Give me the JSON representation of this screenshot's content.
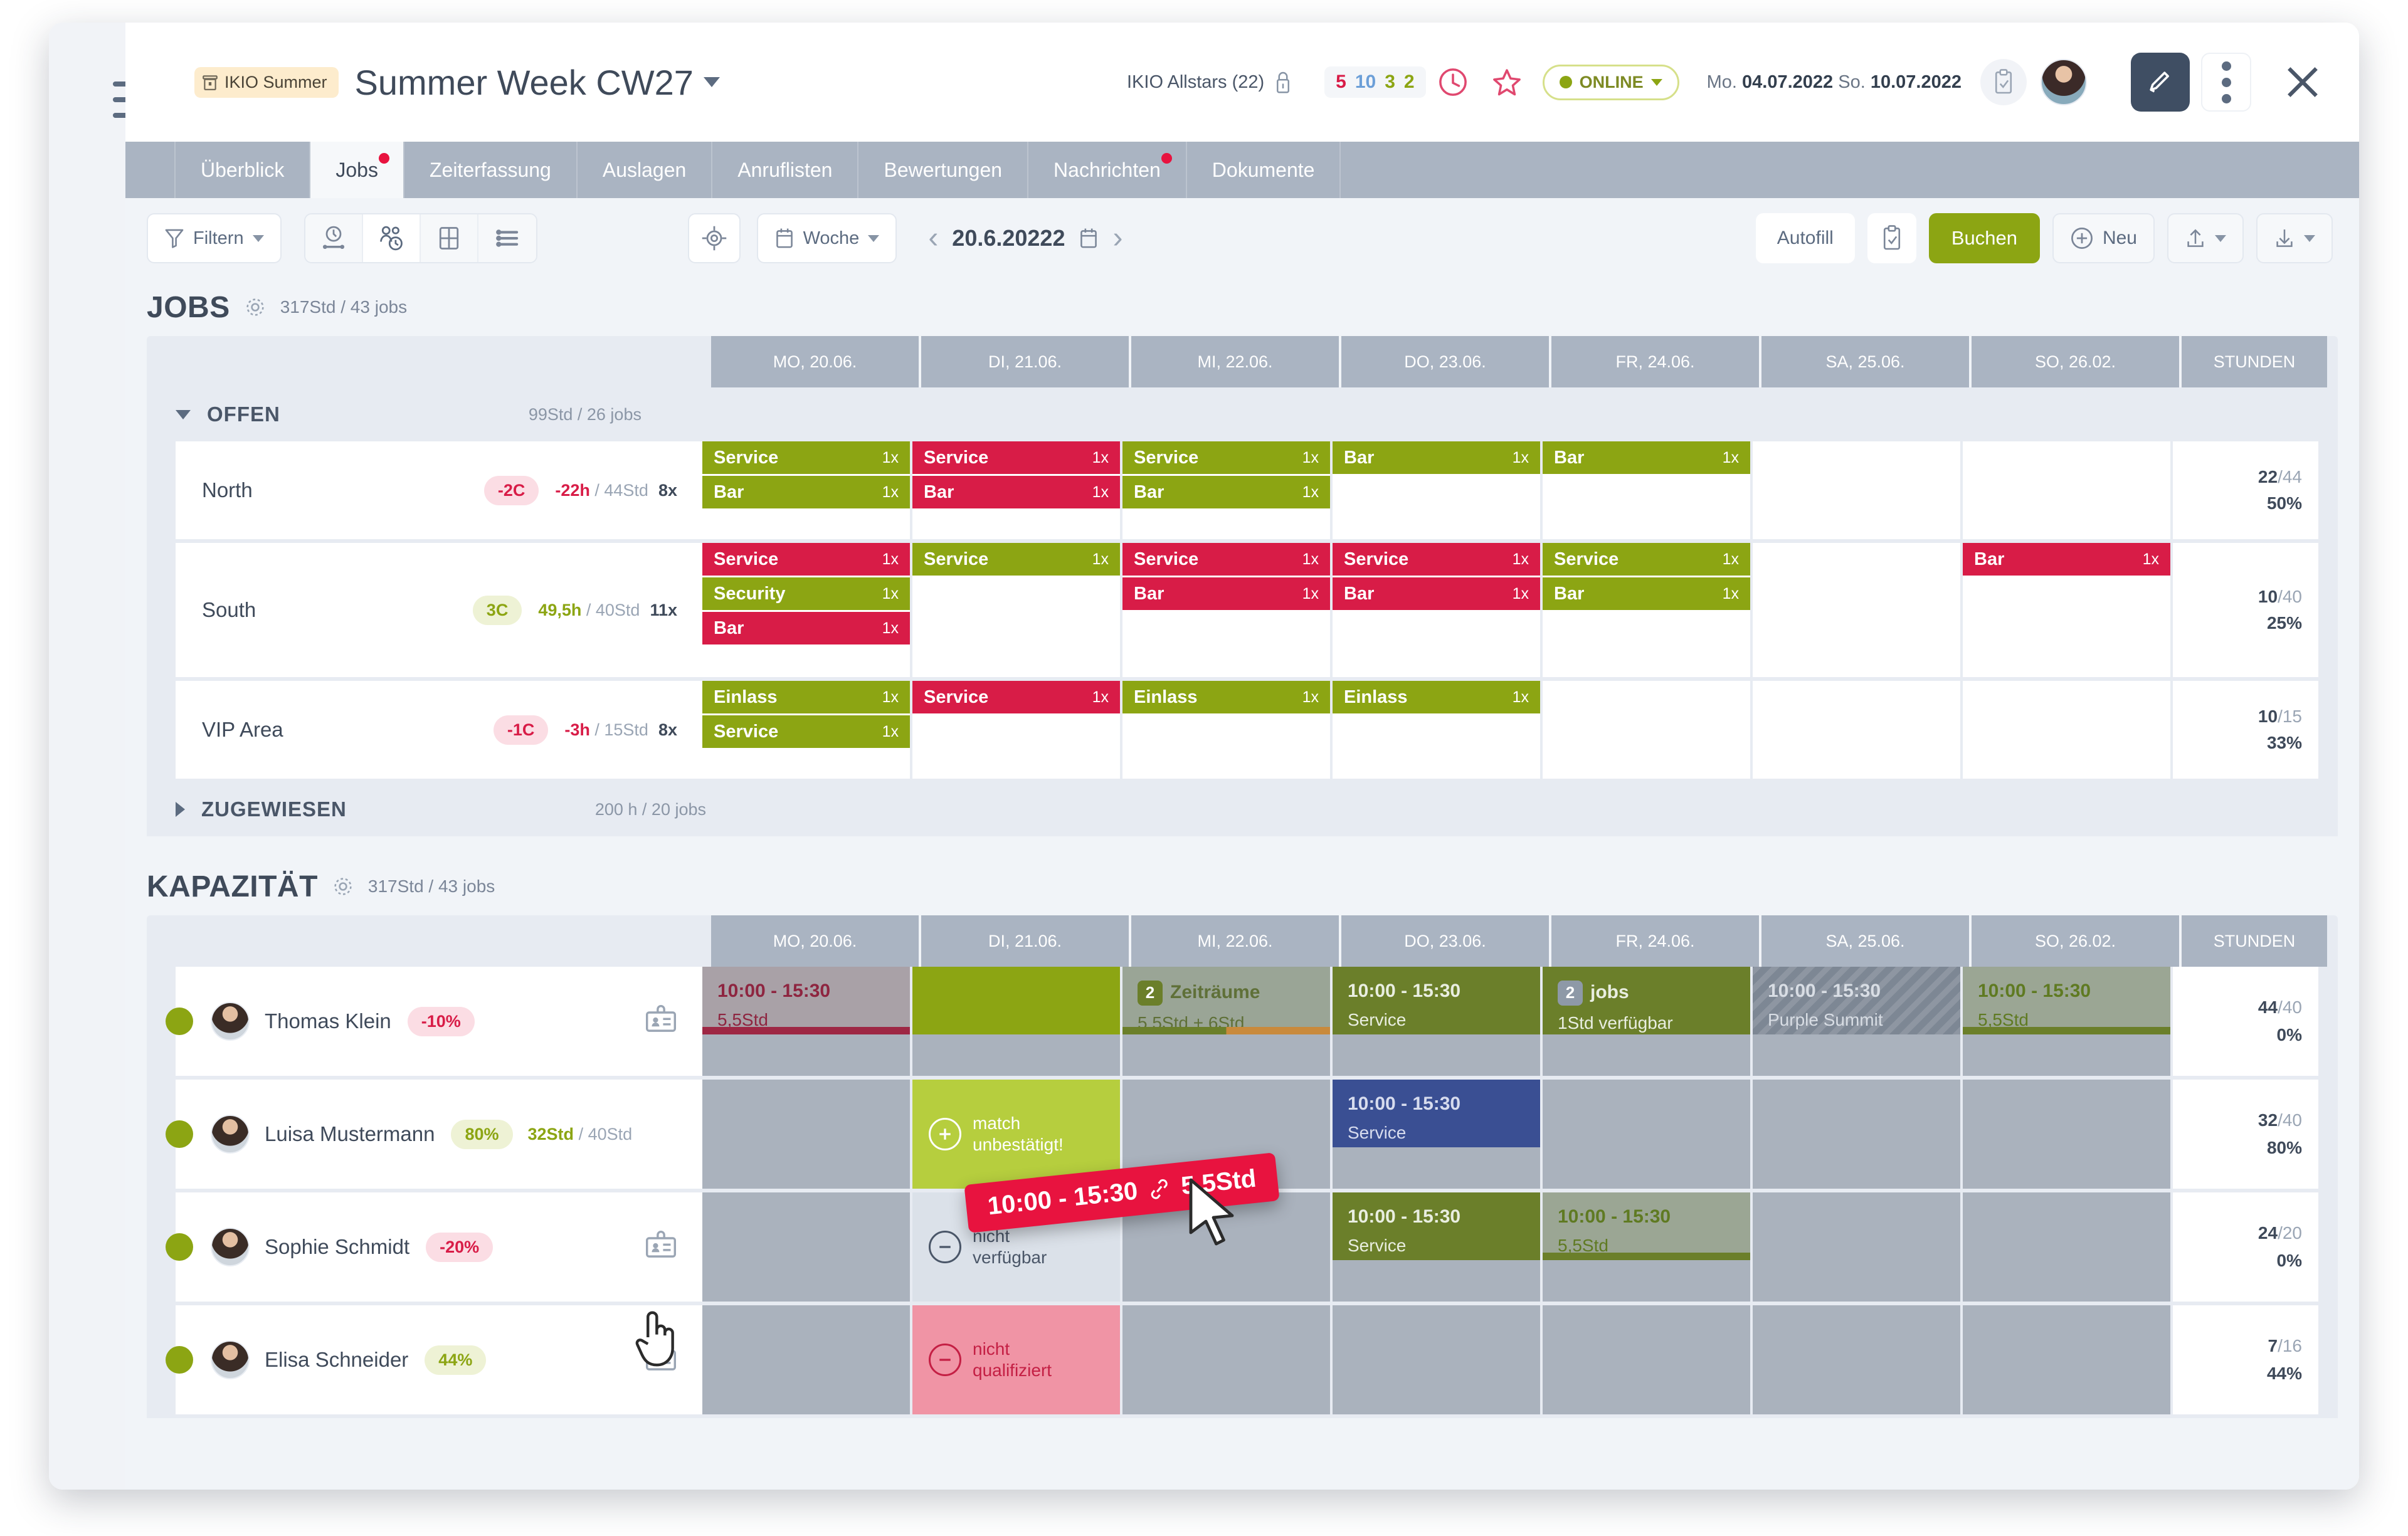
{
  "header": {
    "project_chip": "IKIO Summer",
    "project_chip_icon": "building-icon",
    "title": "Summer Week CW27",
    "team": "IKIO Allstars (22)",
    "lock_icon": "lock-icon",
    "counts": [
      "5",
      "10",
      "3",
      "2"
    ],
    "count_colors": [
      "#d81c47",
      "#6c9fd8",
      "#8ca513",
      "#8ca513"
    ],
    "clock_icon": "clock-icon",
    "star_icon": "star-icon",
    "status": "ONLINE",
    "date_prefix_from": "Mo.",
    "date_from": "04.07.2022",
    "date_prefix_to": "So.",
    "date_to": "10.07.2022",
    "clipboard_icon": "clipboard-check-icon",
    "avatar_icon": "user-avatar",
    "edit_icon": "pencil-icon",
    "more_icon": "kebab-menu-icon",
    "close_icon": "close-icon"
  },
  "tabs": [
    {
      "label": "Überblick",
      "active": false,
      "badge": false
    },
    {
      "label": "Jobs",
      "active": true,
      "badge": true
    },
    {
      "label": "Zeiterfassung",
      "active": false,
      "badge": false
    },
    {
      "label": "Auslagen",
      "active": false,
      "badge": false
    },
    {
      "label": "Anruflisten",
      "active": false,
      "badge": false
    },
    {
      "label": "Bewertungen",
      "active": false,
      "badge": false
    },
    {
      "label": "Nachrichten",
      "active": false,
      "badge": true
    },
    {
      "label": "Dokumente",
      "active": false,
      "badge": false
    }
  ],
  "toolbar": {
    "filter_label": "Filtern",
    "filter_icon": "funnel-icon",
    "view_buttons": [
      {
        "icon": "timeline-icon",
        "active": false
      },
      {
        "icon": "people-clock-icon",
        "active": true
      },
      {
        "icon": "grid-icon",
        "active": false
      },
      {
        "icon": "list-icon",
        "active": false
      }
    ],
    "target_icon": "crosshair-icon",
    "period_label": "Woche",
    "period_icon": "calendar-icon",
    "prev_icon": "chevron-left-icon",
    "next_icon": "chevron-right-icon",
    "current_date": "20.6.20222",
    "date_picker_icon": "calendar-icon",
    "autofill_label": "Autofill",
    "checklist_icon": "clipboard-check-icon",
    "book_label": "Buchen",
    "new_label": "Neu",
    "new_icon": "plus-circle-icon",
    "upload_icon": "upload-icon",
    "download_icon": "download-icon"
  },
  "jobs": {
    "title": "JOBS",
    "gear_icon": "gear-icon",
    "meta": "317Std / 43 jobs",
    "columns": [
      "MO, 20.06.",
      "DI, 21.06.",
      "MI, 22.06.",
      "DO, 23.06.",
      "FR, 24.06.",
      "SA, 25.06.",
      "SO, 26.02.",
      "STUNDEN"
    ],
    "groups": [
      {
        "name": "OFFEN",
        "meta": "99Std / 26 jobs",
        "expanded": true,
        "rows": [
          {
            "name": "North",
            "pill": "-2C",
            "pill_tone": "red",
            "hours": "-22h",
            "hours_tone": "red",
            "hours_total": "/ 44Std",
            "count": "8x",
            "days": [
              [
                {
                  "label": "Service",
                  "qty": "1x",
                  "tone": "g"
                },
                {
                  "label": "Bar",
                  "qty": "1x",
                  "tone": "g"
                }
              ],
              [
                {
                  "label": "Service",
                  "qty": "1x",
                  "tone": "r"
                },
                {
                  "label": "Bar",
                  "qty": "1x",
                  "tone": "r"
                }
              ],
              [
                {
                  "label": "Service",
                  "qty": "1x",
                  "tone": "g"
                },
                {
                  "label": "Bar",
                  "qty": "1x",
                  "tone": "g"
                }
              ],
              [
                {
                  "label": "Bar",
                  "qty": "1x",
                  "tone": "g"
                }
              ],
              [
                {
                  "label": "Bar",
                  "qty": "1x",
                  "tone": "g"
                }
              ],
              [],
              []
            ],
            "hours_cell": {
              "ratio": "22",
              "ratio_total": "/44",
              "pct": "50%"
            }
          },
          {
            "name": "South",
            "pill": "3C",
            "pill_tone": "green",
            "hours": "49,5h",
            "hours_tone": "green",
            "hours_total": "/ 40Std",
            "count": "11x",
            "days": [
              [
                {
                  "label": "Service",
                  "qty": "1x",
                  "tone": "r"
                },
                {
                  "label": "Security",
                  "qty": "1x",
                  "tone": "g"
                },
                {
                  "label": "Bar",
                  "qty": "1x",
                  "tone": "r"
                }
              ],
              [
                {
                  "label": "Service",
                  "qty": "1x",
                  "tone": "g"
                }
              ],
              [
                {
                  "label": "Service",
                  "qty": "1x",
                  "tone": "r"
                },
                {
                  "label": "Bar",
                  "qty": "1x",
                  "tone": "r"
                }
              ],
              [
                {
                  "label": "Service",
                  "qty": "1x",
                  "tone": "r"
                },
                {
                  "label": "Bar",
                  "qty": "1x",
                  "tone": "r"
                }
              ],
              [
                {
                  "label": "Service",
                  "qty": "1x",
                  "tone": "g"
                },
                {
                  "label": "Bar",
                  "qty": "1x",
                  "tone": "g"
                }
              ],
              [],
              [
                {
                  "label": "Bar",
                  "qty": "1x",
                  "tone": "r"
                }
              ]
            ],
            "hours_cell": {
              "ratio": "10",
              "ratio_total": "/40",
              "pct": "25%"
            }
          },
          {
            "name": "VIP Area",
            "pill": "-1C",
            "pill_tone": "red",
            "hours": "-3h",
            "hours_tone": "red",
            "hours_total": "/ 15Std",
            "count": "8x",
            "days": [
              [
                {
                  "label": "Einlass",
                  "qty": "1x",
                  "tone": "g"
                },
                {
                  "label": "Service",
                  "qty": "1x",
                  "tone": "g"
                }
              ],
              [
                {
                  "label": "Service",
                  "qty": "1x",
                  "tone": "r"
                }
              ],
              [
                {
                  "label": "Einlass",
                  "qty": "1x",
                  "tone": "g"
                }
              ],
              [
                {
                  "label": "Einlass",
                  "qty": "1x",
                  "tone": "g"
                }
              ],
              [],
              [],
              []
            ],
            "hours_cell": {
              "ratio": "10",
              "ratio_total": "/15",
              "pct": "33%"
            }
          }
        ]
      },
      {
        "name": "ZUGEWIESEN",
        "meta": "200 h / 20 jobs",
        "expanded": false,
        "rows": []
      }
    ]
  },
  "capacity": {
    "title": "KAPAZITÄT",
    "gear_icon": "gear-icon",
    "meta": "317Std / 43 jobs",
    "columns": [
      "MO, 20.06.",
      "DI, 21.06.",
      "MI, 22.06.",
      "DO, 23.06.",
      "FR, 24.06.",
      "SA, 25.06.",
      "SO, 26.02.",
      "STUNDEN"
    ],
    "rows": [
      {
        "name": "Thomas Klein",
        "pill": "-10%",
        "pill_tone": "red",
        "hours": "",
        "hours_total": "",
        "badge_icon": "id-card-icon",
        "hours_cell": {
          "ratio": "44",
          "ratio_total": "/40",
          "pct": "0%"
        },
        "cells": [
          {
            "kind": "block",
            "time": "10:00 - 15:30",
            "sub": "5,5Std",
            "style": "grey-red"
          },
          {
            "kind": "block",
            "time": "",
            "sub": "",
            "style": "green-solid"
          },
          {
            "kind": "block",
            "time": "Zeiträume",
            "sub": "5,5Std + 6Std",
            "style": "grey-green-two",
            "badge": "2"
          },
          {
            "kind": "block",
            "time": "10:00 - 15:30",
            "sub": "Service",
            "style": "olive"
          },
          {
            "kind": "block",
            "time": "jobs",
            "sub": "1Std verfügbar",
            "style": "olive",
            "badge": "2"
          },
          {
            "kind": "block",
            "time": "10:00 - 15:30",
            "sub": "Purple Summit",
            "style": "hatched"
          },
          {
            "kind": "block",
            "time": "10:00 - 15:30",
            "sub": "5,5Std",
            "style": "grey-olive"
          }
        ]
      },
      {
        "name": "Luisa Mustermann",
        "pill": "80%",
        "pill_tone": "green",
        "hours": "32Std",
        "hours_total": "/ 40Std",
        "badge_icon": "",
        "hours_cell": {
          "ratio": "32",
          "ratio_total": "/40",
          "pct": "80%"
        },
        "cells": [
          {
            "kind": "empty"
          },
          {
            "kind": "mid",
            "icon": "plus-circle-icon",
            "line1": "match",
            "line2": "unbestätigt!",
            "style": "lightgreen"
          },
          {
            "kind": "empty"
          },
          {
            "kind": "block",
            "time": "10:00 - 15:30",
            "sub": "Service",
            "style": "blue"
          },
          {
            "kind": "empty"
          },
          {
            "kind": "empty"
          },
          {
            "kind": "empty"
          }
        ]
      },
      {
        "name": "Sophie Schmidt",
        "pill": "-20%",
        "pill_tone": "red",
        "hours": "",
        "hours_total": "",
        "badge_icon": "id-card-icon",
        "hours_cell": {
          "ratio": "24",
          "ratio_total": "/20",
          "pct": "0%"
        },
        "cells": [
          {
            "kind": "empty"
          },
          {
            "kind": "mid",
            "icon": "minus-circle-icon",
            "line1": "nicht",
            "line2": "verfügbar",
            "style": "lightgrey"
          },
          {
            "kind": "empty"
          },
          {
            "kind": "block",
            "time": "10:00 - 15:30",
            "sub": "Service",
            "style": "olive"
          },
          {
            "kind": "block",
            "time": "10:00 - 15:30",
            "sub": "5,5Std",
            "style": "grey-olive"
          },
          {
            "kind": "empty"
          },
          {
            "kind": "empty"
          }
        ]
      },
      {
        "name": "Elisa Schneider",
        "pill": "44%",
        "pill_tone": "green",
        "hours": "",
        "hours_total": "",
        "badge_icon": "id-card-icon",
        "hours_cell": {
          "ratio": "7",
          "ratio_total": "/16",
          "pct": "44%"
        },
        "cells": [
          {
            "kind": "empty"
          },
          {
            "kind": "mid",
            "icon": "minus-circle-icon",
            "line1": "nicht",
            "line2": "qualifiziert",
            "style": "pink"
          },
          {
            "kind": "empty"
          },
          {
            "kind": "empty"
          },
          {
            "kind": "empty"
          },
          {
            "kind": "empty"
          },
          {
            "kind": "empty"
          }
        ]
      }
    ]
  },
  "drag": {
    "time": "10:00 - 15:30",
    "link_icon": "link-icon",
    "hours": "5,5Std"
  },
  "colors": {
    "green": "#8ca513",
    "red": "#d81c47",
    "crimson": "#e8133f",
    "blue": "#3a4f93",
    "olive": "#6b7f2a",
    "header_grey": "#aab4c2",
    "cell_grey": "#aab2bd"
  }
}
